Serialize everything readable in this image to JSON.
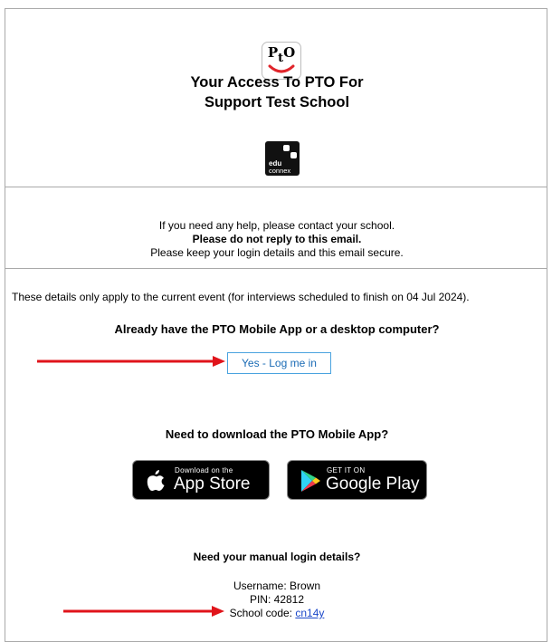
{
  "header": {
    "logo_text_p": "P",
    "logo_text_t": "t",
    "logo_text_o": "O",
    "title_line1": "Your Access To PTO For",
    "title_line2": "Support Test School",
    "edu_text1": "edu",
    "edu_text2": "connex"
  },
  "help": {
    "line1": "If you need any help, please contact your school.",
    "line2": "Please do not reply to this email.",
    "line3": "Please keep your login details and this email secure."
  },
  "details_note": "These details only apply to the current event (for interviews scheduled to finish on 04 Jul 2024).",
  "login_section": {
    "question": "Already have the PTO Mobile App or a desktop computer?",
    "button_label": "Yes - Log me in"
  },
  "download_section": {
    "question": "Need to download the PTO Mobile App?",
    "appstore_small": "Download on the",
    "appstore_big": "App Store",
    "gplay_small": "GET IT ON",
    "gplay_big": "Google Play"
  },
  "manual_section": {
    "question": "Need your manual login details?",
    "username_label": "Username: Brown",
    "pin_label": "PIN: 42812",
    "school_code_label": "School code: ",
    "school_code_value": "cn14y"
  },
  "colors": {
    "arrow": "#e0141b",
    "button_border": "#4aa3df",
    "link": "#1a47c9",
    "logo_smile": "#e0252b"
  }
}
